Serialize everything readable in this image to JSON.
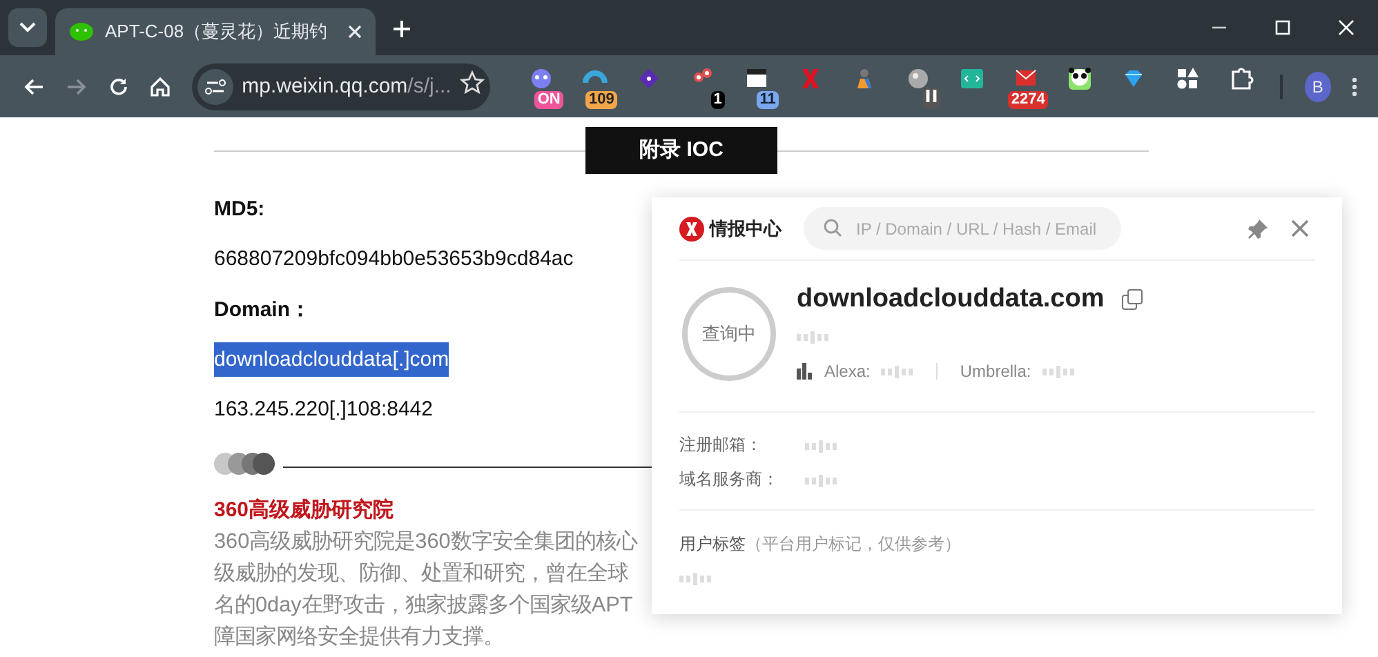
{
  "browser": {
    "tab": {
      "title": "APT-C-08（蔓灵花）近期钓",
      "selected": true
    },
    "url": {
      "host": "mp.weixin.qq.com",
      "path": "/s/j..."
    },
    "extensions": [
      {
        "kind": "ghost",
        "badge": "ON"
      },
      {
        "kind": "gauge",
        "badge": "109"
      },
      {
        "kind": "diamond"
      },
      {
        "kind": "dots",
        "badge": "1"
      },
      {
        "kind": "calendar",
        "badge": "11"
      },
      {
        "kind": "cross"
      },
      {
        "kind": "figure"
      },
      {
        "kind": "globe",
        "paused": true
      },
      {
        "kind": "code"
      },
      {
        "kind": "mail",
        "badge": "2274"
      },
      {
        "kind": "panda"
      },
      {
        "kind": "gem"
      },
      {
        "kind": "shapes"
      },
      {
        "kind": "puzzle"
      }
    ],
    "profile": "B"
  },
  "article": {
    "section_title": "附录 IOC",
    "md5_label": "MD5:",
    "md5": "668807209bfc094bb0e53653b9cd84ac",
    "domain_label": "Domain：",
    "domain": "downloadclouddata[.]com",
    "domain_selected": true,
    "ip": "163.245.220[.]108:8442",
    "org_title": "360高级威胁研究院",
    "org_lines": [
      "360高级威胁研究院是360数字安全集团的核心",
      "级威胁的发现、防御、处置和研究，曾在全球",
      "名的0day在野攻击，独家披露多个国家级APT",
      "障国家网络安全提供有力支撑。"
    ]
  },
  "popup": {
    "brand": "情报中心",
    "search": {
      "placeholder": "IP / Domain / URL / Hash / Email"
    },
    "status": "查询中",
    "domain": "downloadclouddata.com",
    "alexa_label": "Alexa:",
    "umbrella_label": "Umbrella:",
    "fields": [
      {
        "label": "注册邮箱："
      },
      {
        "label": "域名服务商："
      }
    ],
    "tags_label": "用户标签",
    "tags_note": "（平台用户标记，仅供参考）"
  }
}
